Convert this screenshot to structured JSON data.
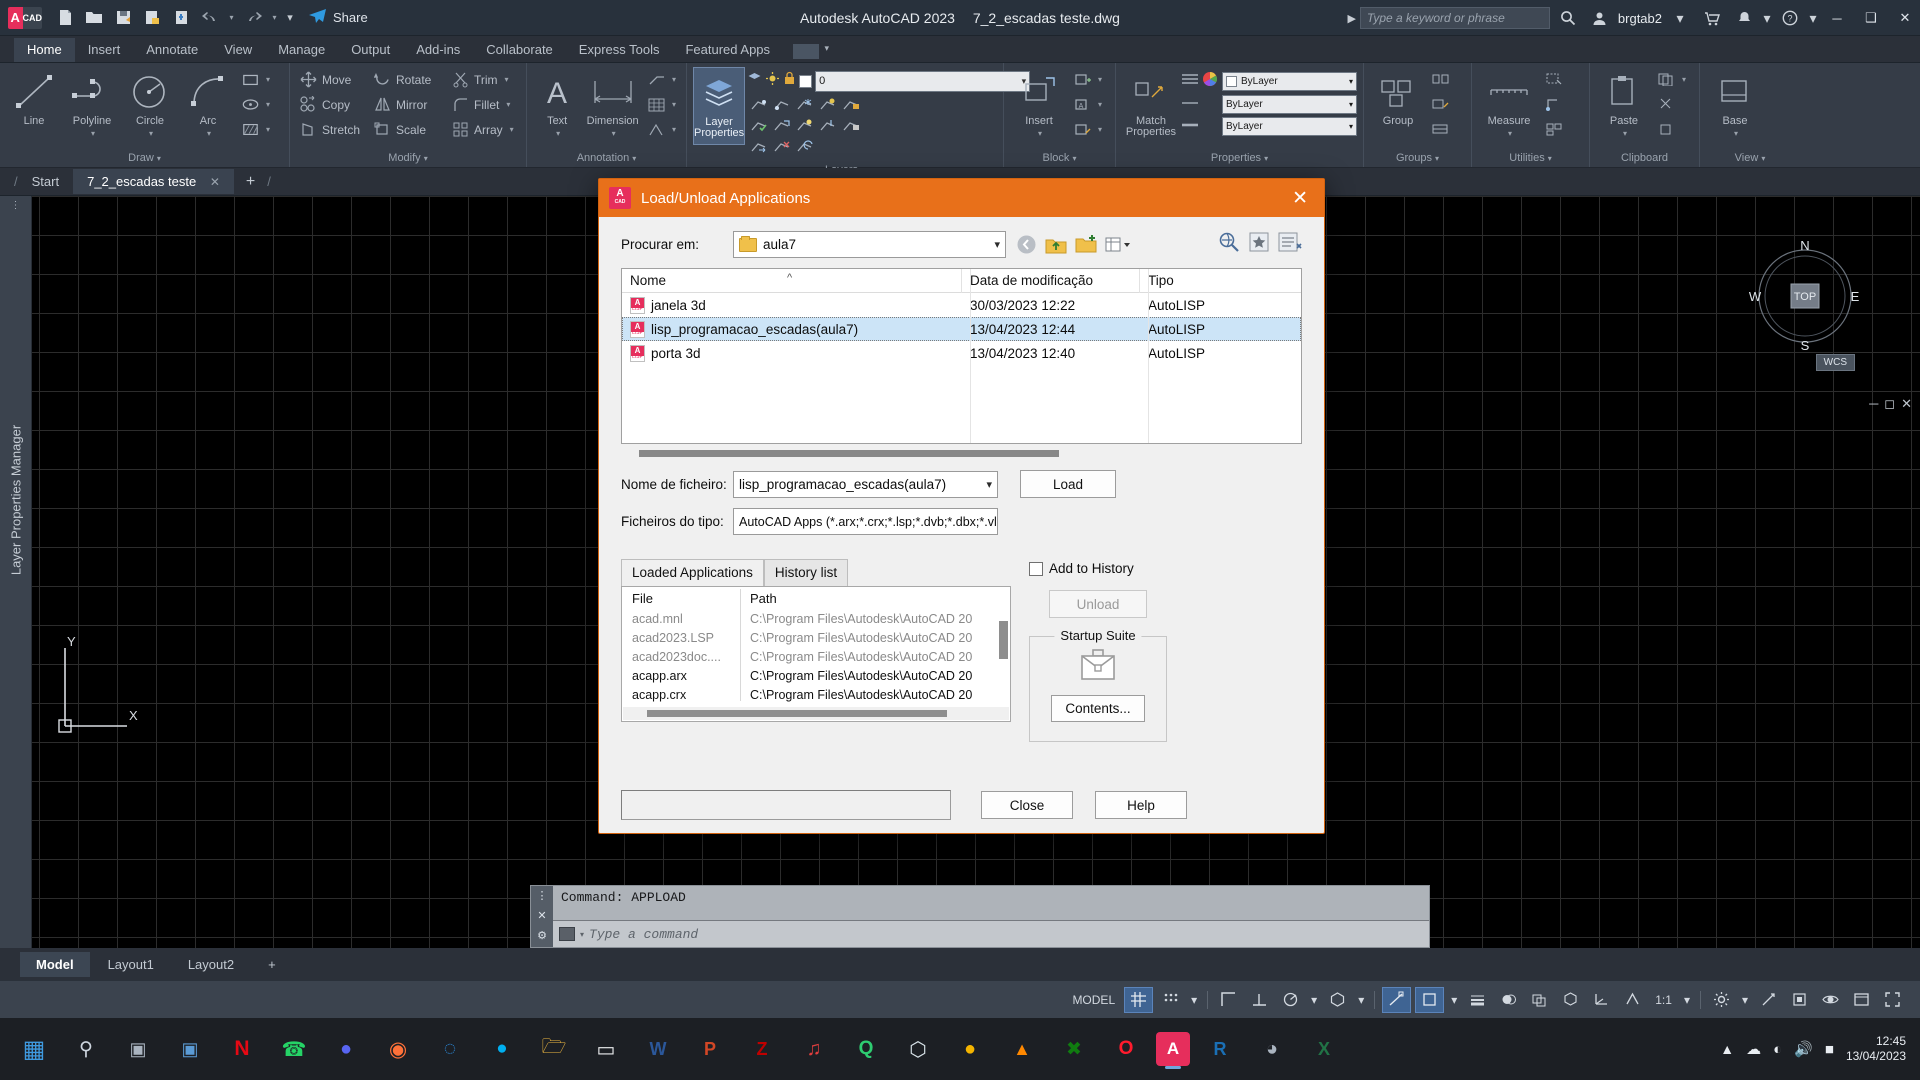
{
  "titlebar": {
    "logo_a": "A",
    "logo_cad": "CAD",
    "quick_access": [
      {
        "name": "new-file-icon",
        "glyph": "🗋"
      },
      {
        "name": "open-file-icon",
        "glyph": "📂"
      },
      {
        "name": "save-icon",
        "glyph": "💾"
      },
      {
        "name": "save-as-icon",
        "glyph": "🗂"
      },
      {
        "name": "plot-icon",
        "glyph": "🖨"
      },
      {
        "name": "undo-icon",
        "glyph": "↶"
      },
      {
        "name": "undo-dropdown-icon",
        "glyph": "▾"
      },
      {
        "name": "redo-icon",
        "glyph": "↷"
      },
      {
        "name": "redo-dropdown-icon",
        "glyph": "▾"
      },
      {
        "name": "customize-qat-icon",
        "glyph": "▾"
      }
    ],
    "share_label": "Share",
    "app_title": "Autodesk AutoCAD 2023",
    "file_name": "7_2_escadas teste.dwg",
    "search_placeholder": "Type a keyword or phrase",
    "user_name": "brgtab2",
    "minimize": "─",
    "maximize": "❑",
    "close": "✕"
  },
  "ribbon_tabs": [
    {
      "label": "Home",
      "active": true
    },
    {
      "label": "Insert",
      "active": false
    },
    {
      "label": "Annotate",
      "active": false
    },
    {
      "label": "View",
      "active": false
    },
    {
      "label": "Manage",
      "active": false
    },
    {
      "label": "Output",
      "active": false
    },
    {
      "label": "Add-ins",
      "active": false
    },
    {
      "label": "Collaborate",
      "active": false
    },
    {
      "label": "Express Tools",
      "active": false
    },
    {
      "label": "Featured Apps",
      "active": false
    }
  ],
  "ribbon": {
    "draw": {
      "title": "Draw",
      "buttons": [
        {
          "label": "Line"
        },
        {
          "label": "Polyline"
        },
        {
          "label": "Circle"
        },
        {
          "label": "Arc"
        }
      ]
    },
    "modify": {
      "title": "Modify",
      "items": [
        {
          "label": "Move"
        },
        {
          "label": "Rotate"
        },
        {
          "label": "Trim"
        },
        {
          "label": "Copy"
        },
        {
          "label": "Mirror"
        },
        {
          "label": "Fillet"
        },
        {
          "label": "Stretch"
        },
        {
          "label": "Scale"
        },
        {
          "label": "Array"
        }
      ]
    },
    "annotation": {
      "title": "Annotation",
      "text_label": "Text",
      "dimension_label": "Dimension"
    },
    "layers": {
      "title": "Layers",
      "layer_properties_label": "Layer\nProperties",
      "current_layer": "0"
    },
    "block": {
      "title": "Block",
      "insert_label": "Insert"
    },
    "properties": {
      "title": "Properties",
      "match_properties_label": "Match\nProperties",
      "color": "ByLayer",
      "linetype": "ByLayer",
      "lineweight": "ByLayer"
    },
    "groups": {
      "title": "Groups",
      "group_label": "Group"
    },
    "utilities": {
      "title": "Utilities",
      "measure_label": "Measure"
    },
    "clipboard": {
      "title": "Clipboard",
      "paste_label": "Paste"
    },
    "view": {
      "title": "View",
      "base_label": "Base"
    }
  },
  "file_tabs": [
    {
      "label": "Start",
      "active": false,
      "closable": false
    },
    {
      "label": "7_2_escadas teste",
      "active": true,
      "closable": true
    }
  ],
  "file_tabs_add": "+",
  "canvas": {
    "palette_title": "Layer Properties Manager",
    "viewcube": {
      "top": "TOP",
      "north": "N",
      "south": "S",
      "east": "E",
      "west": "W"
    },
    "wcs_badge": "WCS",
    "axis_x": "X",
    "axis_y": "Y"
  },
  "command_line": {
    "history": "Command: APPLOAD",
    "placeholder": "Type a command"
  },
  "layout_tabs": [
    {
      "label": "Model",
      "active": true
    },
    {
      "label": "Layout1",
      "active": false
    },
    {
      "label": "Layout2",
      "active": false
    },
    {
      "label": "+",
      "active": false
    }
  ],
  "status_bar": {
    "model_label": "MODEL",
    "scale": "1:1",
    "icons": [
      "grid-display-icon",
      "snap-mode-icon",
      "snap-dropdown-icon",
      "ortho-mode-icon",
      "polar-tracking-icon",
      "isometric-drafting-icon",
      "object-snap-tracking-icon",
      "object-snap-icon",
      "object-snap-dropdown-icon",
      "lineweight-icon",
      "transparency-icon",
      "transparency-dropdown-icon",
      "selection-cycling-icon",
      "3d-object-snap-icon",
      "dynamic-ucs-icon",
      "annotation-visibility-icon",
      "annotation-scale-icon",
      "workspace-gear-icon",
      "workspace-dropdown-icon",
      "customization-icon",
      "hardware-accel-icon",
      "isolate-objects-icon",
      "clean-screen-icon",
      "fullscreen-icon"
    ]
  },
  "taskbar": {
    "apps": [
      {
        "name": "start-button-icon",
        "glyph": "⊞",
        "color": "#2f8fd8"
      },
      {
        "name": "search-icon",
        "glyph": "🔍",
        "color": "#c8d0da"
      },
      {
        "name": "task-view-icon",
        "glyph": "❑",
        "color": "#a9b4c0"
      },
      {
        "name": "widgets-icon",
        "glyph": "▣",
        "color": "#5b9bd5"
      },
      {
        "name": "netflix-icon",
        "glyph": "N",
        "color": "#e50914"
      },
      {
        "name": "whatsapp-icon",
        "glyph": "✆",
        "color": "#25d366"
      },
      {
        "name": "discord-icon",
        "glyph": "◐",
        "color": "#5865f2"
      },
      {
        "name": "firefox-icon",
        "glyph": "◉",
        "color": "#ff7139"
      },
      {
        "name": "edge-icon",
        "glyph": "◔",
        "color": "#2b88d8"
      },
      {
        "name": "skype-icon",
        "glyph": "S",
        "color": "#00aff0"
      },
      {
        "name": "file-explorer-icon",
        "glyph": "📁",
        "color": "#f5bc42"
      },
      {
        "name": "notepad-icon",
        "glyph": "▭",
        "color": "#e8eaec"
      },
      {
        "name": "word-icon",
        "glyph": "W",
        "color": "#2b579a"
      },
      {
        "name": "powerpoint-icon",
        "glyph": "P",
        "color": "#d24726"
      },
      {
        "name": "filezilla-icon",
        "glyph": "Z",
        "color": "#bf0000"
      },
      {
        "name": "audio-icon",
        "glyph": "♫",
        "color": "#e03e3e"
      },
      {
        "name": "qbittorrent-icon",
        "glyph": "Q",
        "color": "#2ecc71"
      },
      {
        "name": "sketchup-icon",
        "glyph": "⬡",
        "color": "#d9e4ea"
      },
      {
        "name": "chrome-icon",
        "glyph": "●",
        "color": "#f4b400"
      },
      {
        "name": "vlc-icon",
        "glyph": "▲",
        "color": "#ff8800"
      },
      {
        "name": "xbox-icon",
        "glyph": "✕",
        "color": "#107c10"
      },
      {
        "name": "opera-icon",
        "glyph": "O",
        "color": "#ff1b2d"
      },
      {
        "name": "autocad-icon",
        "glyph": "A",
        "color": "#e62e5c",
        "active": true
      },
      {
        "name": "revit-icon",
        "glyph": "R",
        "color": "#1a6fb5"
      },
      {
        "name": "rhino-icon",
        "glyph": "◑",
        "color": "#8c8c8c"
      },
      {
        "name": "excel-icon",
        "glyph": "X",
        "color": "#217346"
      }
    ],
    "tray": [
      "show-hidden-icons",
      "onedrive-icon",
      "wifi-icon",
      "volume-icon",
      "battery-icon"
    ],
    "clock_time": "12:45",
    "clock_date": "13/04/2023"
  },
  "dialog": {
    "title": "Load/Unload Applications",
    "close_glyph": "✕",
    "look_in_label": "Procurar em:",
    "look_in_value": "aula7",
    "nav_icons": [
      "back-icon",
      "up-one-level-icon",
      "create-folder-icon",
      "views-icon"
    ],
    "right_icons": [
      "search-web-icon",
      "add-favorite-icon",
      "tools-icon"
    ],
    "file_list": {
      "columns": [
        "Nome",
        "Data de modificação",
        "Tipo"
      ],
      "rows": [
        {
          "name": "janela 3d",
          "modified": "30/03/2023 12:22",
          "type": "AutoLISP",
          "selected": false
        },
        {
          "name": "lisp_programacao_escadas(aula7)",
          "modified": "13/04/2023 12:44",
          "type": "AutoLISP",
          "selected": true
        },
        {
          "name": "porta 3d",
          "modified": "13/04/2023 12:40",
          "type": "AutoLISP",
          "selected": false
        }
      ]
    },
    "file_name_label": "Nome de ficheiro:",
    "file_name_value": "lisp_programacao_escadas(aula7)",
    "file_type_label": "Ficheiros do tipo:",
    "file_type_value": "AutoCAD Apps (*.arx;*.crx;*.lsp;*.dvb;*.dbx;*.vlx;*.fa",
    "load_button": "Load",
    "tabs": [
      {
        "label": "Loaded Applications",
        "active": true
      },
      {
        "label": "History list",
        "active": false
      }
    ],
    "loaded_list": {
      "columns": [
        "File",
        "Path"
      ],
      "rows": [
        {
          "file": "acad.mnl",
          "path": "C:\\Program Files\\Autodesk\\AutoCAD 20",
          "dim": true
        },
        {
          "file": "acad2023.LSP",
          "path": "C:\\Program Files\\Autodesk\\AutoCAD 20",
          "dim": true
        },
        {
          "file": "acad2023doc....",
          "path": "C:\\Program Files\\Autodesk\\AutoCAD 20",
          "dim": true
        },
        {
          "file": "acapp.arx",
          "path": "C:\\Program Files\\Autodesk\\AutoCAD 20",
          "dim": false
        },
        {
          "file": "acapp.crx",
          "path": "C:\\Program Files\\Autodesk\\AutoCAD 20",
          "dim": false
        }
      ]
    },
    "add_to_history_label": "Add to History",
    "add_to_history_checked": false,
    "unload_button": "Unload",
    "unload_disabled": true,
    "startup_suite_title": "Startup Suite",
    "contents_button": "Contents...",
    "status_text": "",
    "close_button": "Close",
    "help_button": "Help"
  }
}
